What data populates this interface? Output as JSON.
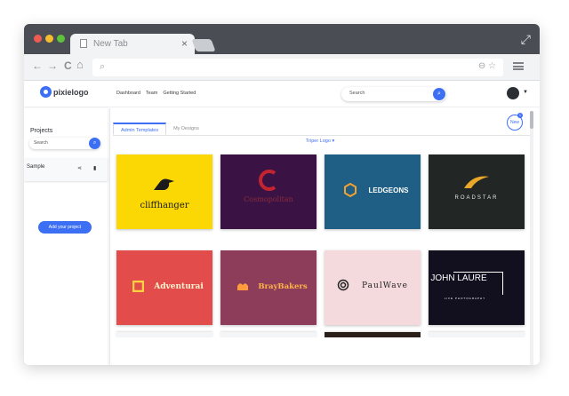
{
  "browser": {
    "tab_title": "New Tab",
    "tab_close": "×",
    "back": "←",
    "forward": "→",
    "reload": "C",
    "home": "⌂",
    "url_search_icon": "⌕",
    "url_right_icons": "⊖ ☆"
  },
  "app": {
    "logo_text": "pixielogo",
    "menu": [
      "Dashboard",
      "Team",
      "Getting Started"
    ],
    "search_placeholder": "Search",
    "accent": "#3d6ff5"
  },
  "sidebar": {
    "title": "Projects",
    "search_placeholder": "Search",
    "project_name": "Sample",
    "add_button": "Add your project"
  },
  "content": {
    "tabs": [
      "Admin Templates",
      "My Designs"
    ],
    "filter": "Triper Logo ▾",
    "new_label": "New",
    "new_badge": "1"
  },
  "cards": [
    {
      "name": "cliffhanger",
      "bg": "#fbd803",
      "fg": "#1b1b1b"
    },
    {
      "name": "Cosmopolitan",
      "bg": "#3a1344",
      "fg": "#8d2a3c"
    },
    {
      "name": "LEDGEONS",
      "bg": "#1f5f86",
      "fg": "#ffffff"
    },
    {
      "name": "ROADSTAR",
      "bg": "#222624",
      "fg": "#e8e8e8"
    },
    {
      "name": "Adventurai",
      "bg": "#e24c4b",
      "fg": "#fff4d0"
    },
    {
      "name": "BrayBakers",
      "bg": "#8d3d5a",
      "fg": "#ffb347"
    },
    {
      "name": "PaulWave",
      "bg": "#f4dadd",
      "fg": "#222222"
    },
    {
      "name": "JOHN LAURE",
      "sub": "LIFE PHOTOGRAPHY",
      "bg": "#120f1e",
      "fg": "#ffffff"
    }
  ]
}
